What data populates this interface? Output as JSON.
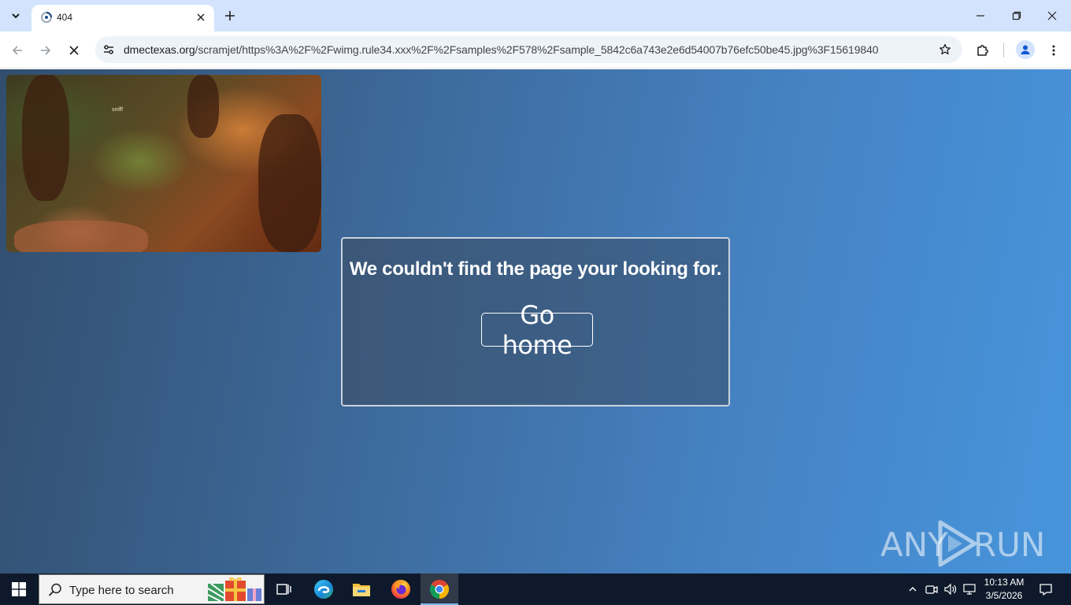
{
  "browser": {
    "tab": {
      "title": "404"
    },
    "address": {
      "host": "dmectexas.org",
      "path": "/scramjet/https%3A%2F%2Fwimg.rule34.xxx%2F%2Fsamples%2F578%2Fsample_5842c6a743e2e6d54007b76efc50be45.jpg%3F15619840"
    },
    "colors": {
      "tabstrip": "#d3e3fd",
      "toolbar": "#ffffff",
      "omnibox": "#eef2f9"
    }
  },
  "page": {
    "video_caption": "sniff!",
    "error_message": "We couldn't find the page your looking for.",
    "go_home_label": "Go home",
    "watermark": {
      "left": "ANY",
      "right": "RUN"
    },
    "colors": {
      "gradient_start": "#324e6e",
      "gradient_end": "#4795dc",
      "text": "#ffffff"
    }
  },
  "taskbar": {
    "search_placeholder": "Type here to search",
    "apps": [
      "task-view",
      "edge",
      "file-explorer",
      "firefox",
      "chrome"
    ],
    "active_app": "chrome",
    "clock": {
      "time": "10:13 AM",
      "date": "3/5/2026"
    },
    "colors": {
      "background": "#0e1a2b"
    }
  }
}
